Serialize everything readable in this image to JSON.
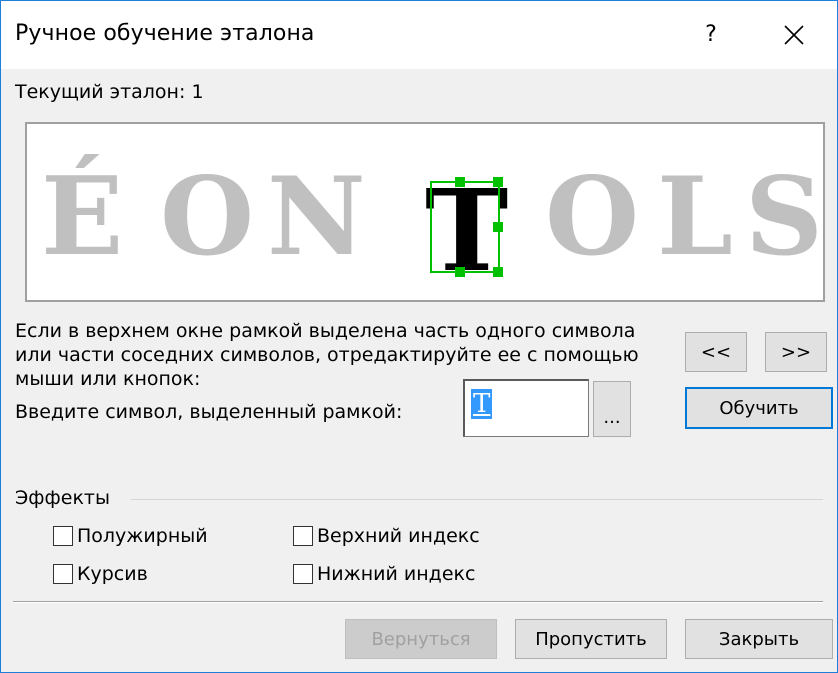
{
  "window": {
    "title": "Ручное обучение эталона",
    "help_label": "?",
    "close_icon": "close-icon"
  },
  "current": {
    "label": "Текущий эталон:",
    "value": "1"
  },
  "preview": {
    "letters": [
      "É",
      "O",
      "N",
      "T",
      "O",
      "L",
      "S"
    ],
    "selected_letter": "T",
    "faded_color": "#c0c0c0",
    "selected_color": "#000000",
    "selection_color": "#00c000"
  },
  "instructions": {
    "text": "Если в верхнем окне рамкой выделена часть одного символа или части соседних символов, отредактируйте ее с помощью мыши или кнопок:"
  },
  "nav": {
    "prev_label": "<<",
    "next_label": ">>"
  },
  "entry": {
    "label": "Введите символ, выделенный рамкой:",
    "value": "T",
    "browse_label": "...",
    "train_label": "Обучить"
  },
  "effects": {
    "title": "Эффекты",
    "bold": "Полужирный",
    "italic": "Курсив",
    "superscript": "Верхний индекс",
    "subscript": "Нижний индекс"
  },
  "footer": {
    "back_label": "Вернуться",
    "skip_label": "Пропустить",
    "close_label": "Закрыть"
  },
  "colors": {
    "accent": "#0078d7",
    "window_border": "#1f7fd8",
    "text_selection": "#3399ff"
  }
}
